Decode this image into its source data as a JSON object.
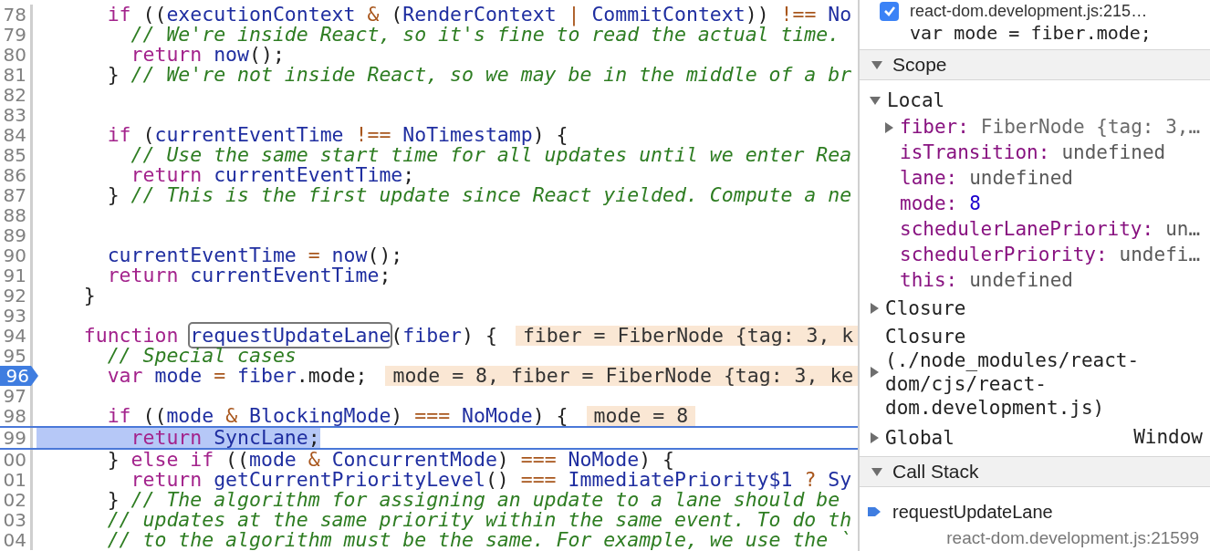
{
  "editor": {
    "lines": [
      {
        "number": "78",
        "breakpoint": false,
        "paused": false,
        "tokens": [
          {
            "kind": "keyword",
            "text": "      if"
          },
          {
            "kind": "plain",
            "text": " (("
          },
          {
            "kind": "name",
            "text": "executionContext"
          },
          {
            "kind": "operator",
            "text": " &"
          },
          {
            "kind": "plain",
            "text": " ("
          },
          {
            "kind": "name",
            "text": "RenderContext"
          },
          {
            "kind": "operator",
            "text": " |"
          },
          {
            "kind": "name",
            "text": " CommitContext"
          },
          {
            "kind": "plain",
            "text": "))"
          },
          {
            "kind": "operator",
            "text": " !=="
          },
          {
            "kind": "name",
            "text": " No"
          }
        ]
      },
      {
        "number": "79",
        "breakpoint": false,
        "paused": false,
        "tokens": [
          {
            "kind": "comment",
            "text": "        // We're inside React, so it's fine to read the actual time."
          }
        ]
      },
      {
        "number": "80",
        "breakpoint": false,
        "paused": false,
        "tokens": [
          {
            "kind": "keyword",
            "text": "        return"
          },
          {
            "kind": "name",
            "text": " now"
          },
          {
            "kind": "plain",
            "text": "();"
          }
        ]
      },
      {
        "number": "81",
        "breakpoint": false,
        "paused": false,
        "tokens": [
          {
            "kind": "plain",
            "text": "      }"
          },
          {
            "kind": "comment",
            "text": " // We're not inside React, so we may be in the middle of a br"
          }
        ]
      },
      {
        "number": "82",
        "breakpoint": false,
        "paused": false
      },
      {
        "number": "83",
        "breakpoint": false,
        "paused": false
      },
      {
        "number": "84",
        "breakpoint": false,
        "paused": false,
        "tokens": [
          {
            "kind": "keyword",
            "text": "      if"
          },
          {
            "kind": "plain",
            "text": " ("
          },
          {
            "kind": "name",
            "text": "currentEventTime"
          },
          {
            "kind": "operator",
            "text": " !=="
          },
          {
            "kind": "name",
            "text": " NoTimestamp"
          },
          {
            "kind": "plain",
            "text": ") {"
          }
        ]
      },
      {
        "number": "85",
        "breakpoint": false,
        "paused": false,
        "tokens": [
          {
            "kind": "comment",
            "text": "        // Use the same start time for all updates until we enter Rea"
          }
        ]
      },
      {
        "number": "86",
        "breakpoint": false,
        "paused": false,
        "tokens": [
          {
            "kind": "keyword",
            "text": "        return"
          },
          {
            "kind": "name",
            "text": " currentEventTime"
          },
          {
            "kind": "plain",
            "text": ";"
          }
        ]
      },
      {
        "number": "87",
        "breakpoint": false,
        "paused": false,
        "tokens": [
          {
            "kind": "plain",
            "text": "      }"
          },
          {
            "kind": "comment",
            "text": " // This is the first update since React yielded. Compute a ne"
          }
        ]
      },
      {
        "number": "88",
        "breakpoint": false,
        "paused": false
      },
      {
        "number": "89",
        "breakpoint": false,
        "paused": false
      },
      {
        "number": "90",
        "breakpoint": false,
        "paused": false,
        "tokens": [
          {
            "kind": "name",
            "text": "      currentEventTime"
          },
          {
            "kind": "operator",
            "text": " ="
          },
          {
            "kind": "name",
            "text": " now"
          },
          {
            "kind": "plain",
            "text": "();"
          }
        ]
      },
      {
        "number": "91",
        "breakpoint": false,
        "paused": false,
        "tokens": [
          {
            "kind": "keyword",
            "text": "      return"
          },
          {
            "kind": "name",
            "text": " currentEventTime"
          },
          {
            "kind": "plain",
            "text": ";"
          }
        ]
      },
      {
        "number": "92",
        "breakpoint": false,
        "paused": false,
        "tokens": [
          {
            "kind": "plain",
            "text": "    }"
          }
        ]
      },
      {
        "number": "93",
        "breakpoint": false,
        "paused": false
      },
      {
        "number": "94",
        "breakpoint": false,
        "paused": false,
        "tokens": [
          {
            "kind": "keyword",
            "text": "    function "
          },
          {
            "kind": "match",
            "text": "requestUpdateLane"
          },
          {
            "kind": "plain",
            "text": "("
          },
          {
            "kind": "name",
            "text": "fiber"
          },
          {
            "kind": "plain",
            "text": ") {"
          }
        ],
        "inline_value": "fiber = FiberNode {tag: 3, k"
      },
      {
        "number": "95",
        "breakpoint": false,
        "paused": false,
        "tokens": [
          {
            "kind": "comment",
            "text": "      // Special cases"
          }
        ]
      },
      {
        "number": "96",
        "breakpoint": true,
        "paused": false,
        "tokens": [
          {
            "kind": "keyword",
            "text": "      var"
          },
          {
            "kind": "name",
            "text": " mode"
          },
          {
            "kind": "operator",
            "text": " ="
          },
          {
            "kind": "name",
            "text": " fiber"
          },
          {
            "kind": "plain",
            "text": ".mode;"
          }
        ],
        "inline_value": "mode = 8, fiber = FiberNode {tag: 3, ke"
      },
      {
        "number": "97",
        "breakpoint": false,
        "paused": false
      },
      {
        "number": "98",
        "breakpoint": false,
        "paused": false,
        "tokens": [
          {
            "kind": "keyword",
            "text": "      if"
          },
          {
            "kind": "plain",
            "text": " (("
          },
          {
            "kind": "name",
            "text": "mode"
          },
          {
            "kind": "operator",
            "text": " &"
          },
          {
            "kind": "name",
            "text": " BlockingMode"
          },
          {
            "kind": "plain",
            "text": ")"
          },
          {
            "kind": "operator",
            "text": " ==="
          },
          {
            "kind": "name",
            "text": " NoMode"
          },
          {
            "kind": "plain",
            "text": ") {"
          }
        ],
        "inline_value": "mode = 8"
      },
      {
        "number": "99",
        "breakpoint": false,
        "paused": true,
        "tokens": [
          {
            "kind": "keyword",
            "text": "        return"
          },
          {
            "kind": "name",
            "text": " SyncLane"
          },
          {
            "kind": "plain",
            "text": ";"
          }
        ]
      },
      {
        "number": "00",
        "breakpoint": false,
        "paused": false,
        "tokens": [
          {
            "kind": "plain",
            "text": "      }"
          },
          {
            "kind": "keyword",
            "text": " else if"
          },
          {
            "kind": "plain",
            "text": " (("
          },
          {
            "kind": "name",
            "text": "mode"
          },
          {
            "kind": "operator",
            "text": " &"
          },
          {
            "kind": "name",
            "text": " ConcurrentMode"
          },
          {
            "kind": "plain",
            "text": ")"
          },
          {
            "kind": "operator",
            "text": " ==="
          },
          {
            "kind": "name",
            "text": " NoMode"
          },
          {
            "kind": "plain",
            "text": ") {"
          }
        ]
      },
      {
        "number": "01",
        "breakpoint": false,
        "paused": false,
        "tokens": [
          {
            "kind": "keyword",
            "text": "        return"
          },
          {
            "kind": "name",
            "text": " getCurrentPriorityLevel"
          },
          {
            "kind": "plain",
            "text": "()"
          },
          {
            "kind": "operator",
            "text": " ==="
          },
          {
            "kind": "name",
            "text": " ImmediatePriority$1"
          },
          {
            "kind": "operator",
            "text": " ?"
          },
          {
            "kind": "name",
            "text": " Sy"
          }
        ]
      },
      {
        "number": "02",
        "breakpoint": false,
        "paused": false,
        "tokens": [
          {
            "kind": "plain",
            "text": "      }"
          },
          {
            "kind": "comment",
            "text": " // The algorithm for assigning an update to a lane should be"
          }
        ]
      },
      {
        "number": "03",
        "breakpoint": false,
        "paused": false,
        "tokens": [
          {
            "kind": "comment",
            "text": "      // updates at the same priority within the same event. To do th"
          }
        ]
      },
      {
        "number": "04",
        "breakpoint": false,
        "paused": false,
        "tokens": [
          {
            "kind": "comment",
            "text": "      // to the algorithm must be the same. For example, we use the `"
          }
        ]
      }
    ]
  },
  "debugger": {
    "breakpoint": {
      "checked": true,
      "location": "react-dom.development.js:215…",
      "code": "var mode = fiber.mode;"
    },
    "scope": {
      "title": "Scope",
      "expanded": true,
      "groups": [
        {
          "title": "Local",
          "expanded": true,
          "items": [
            {
              "name": "fiber:",
              "expanded": false,
              "kind": "object",
              "value": "FiberNode {tag: 3,…"
            },
            {
              "name": "isTransition:",
              "kind": "undefined",
              "value": "undefined"
            },
            {
              "name": "lane:",
              "kind": "undefined",
              "value": "undefined"
            },
            {
              "name": "mode:",
              "kind": "number",
              "value": "8"
            },
            {
              "name": "schedulerLanePriority:",
              "kind": "undefined",
              "value": "un…"
            },
            {
              "name": "schedulerPriority:",
              "kind": "undefined",
              "value": "undefi…"
            },
            {
              "name": "this:",
              "kind": "undefined",
              "value": "undefined"
            }
          ]
        },
        {
          "title": "Closure",
          "expanded": false
        },
        {
          "title": "Closure (./node_modules/react-dom/cjs/react-dom.development.js)",
          "expanded": false
        },
        {
          "title": "Global",
          "expanded": false,
          "value": "Window"
        }
      ]
    },
    "call_stack": {
      "title": "Call Stack",
      "expanded": true,
      "frames": [
        {
          "function": "requestUpdateLane",
          "location": "react-dom.development.js:21599",
          "selected": true
        }
      ]
    }
  }
}
